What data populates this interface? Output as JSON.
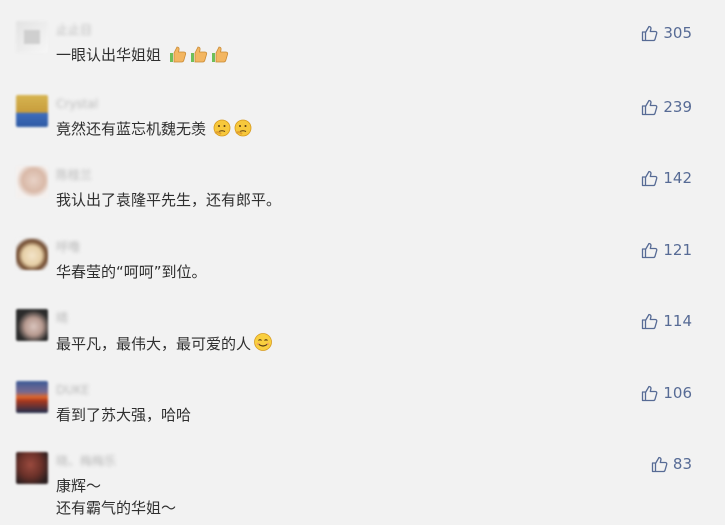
{
  "comments": [
    {
      "nickname": "止止日",
      "text": "一眼认出华姐姐",
      "emoji_icon": "thumbs-up-emoji",
      "emoji_count": 3,
      "likes": "305",
      "avatar_colors": [
        "#d9d9d9",
        "#ededed"
      ]
    },
    {
      "nickname": "Crystal",
      "text": "竟然还有蓝忘机魏无羡",
      "emoji_icon": "thinking-face-emoji",
      "emoji_count": 2,
      "likes": "239",
      "avatar_colors": [
        "#c8a845",
        "#3f6fbf"
      ]
    },
    {
      "nickname": "陈桂兰",
      "text": "我认出了袁隆平先生，还有郎平。",
      "likes": "142",
      "avatar_colors": [
        "#e6cfc3",
        "#6b4f43"
      ]
    },
    {
      "nickname": "呼噜",
      "text": "华春莹的“呵呵”到位。",
      "likes": "121",
      "avatar_colors": [
        "#f0e1c6",
        "#5b3a22"
      ]
    },
    {
      "nickname": "晴",
      "text": "最平凡，最伟大，最可爱的人",
      "emoji_icon": "smiling-face-emoji",
      "emoji_count": 1,
      "likes": "114",
      "avatar_colors": [
        "#2a2a2a",
        "#d8c8c4"
      ]
    },
    {
      "nickname": "DUKE",
      "text": "看到了苏大强，哈哈",
      "likes": "106",
      "avatar_colors": [
        "#b84a2a",
        "#2f4f8f"
      ]
    },
    {
      "nickname": "晓、梅梅乐",
      "text_lines": [
        "康辉～",
        "还有霸气的华姐～"
      ],
      "likes": "83",
      "avatar_colors": [
        "#7a3a32",
        "#3a2a2a"
      ]
    }
  ],
  "colors": {
    "background": "#f2f2f2",
    "like_blue": "#576b95",
    "text": "#2f2f2f",
    "nickname": "#b9b9b9"
  }
}
